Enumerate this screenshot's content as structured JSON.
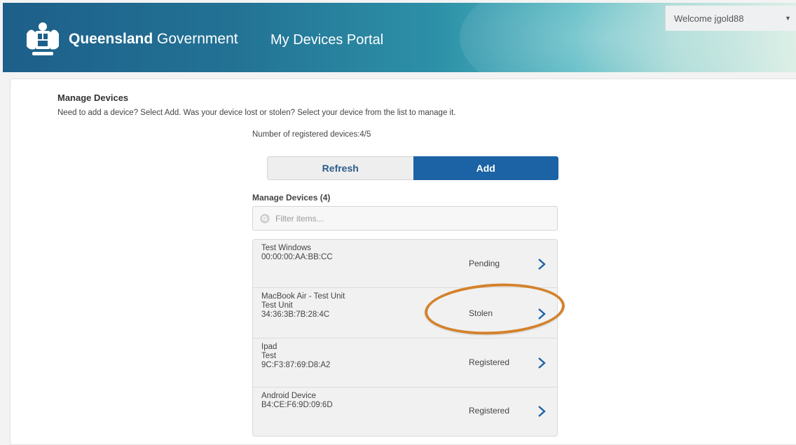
{
  "header": {
    "brand_bold": "Queensland",
    "brand_light": "Government",
    "portal_title": "My Devices Portal",
    "welcome": "Welcome jgold88"
  },
  "main": {
    "title": "Manage Devices",
    "intro": "Need to add a device? Select Add. Was your device lost or stolen? Select your device from the list to manage it.",
    "registered_count": "Number of registered devices:4/5",
    "refresh_label": "Refresh",
    "add_label": "Add",
    "list_title": "Manage Devices (4)",
    "filter_placeholder": "Filter items..."
  },
  "devices": [
    {
      "line1": "Test Windows",
      "line2": "00:00:00:AA:BB:CC",
      "line3": "",
      "status": "Pending"
    },
    {
      "line1": "MacBook Air - Test Unit",
      "line2": "Test Unit",
      "line3": "34:36:3B:7B:28:4C",
      "status": "Stolen"
    },
    {
      "line1": "Ipad",
      "line2": "Test",
      "line3": "9C:F3:87:69:D8:A2",
      "status": "Registered"
    },
    {
      "line1": "Android Device",
      "line2": "B4:CE:F6:9D:09:6D",
      "line3": "",
      "status": "Registered"
    }
  ],
  "colors": {
    "accent": "#1c63a5",
    "highlight": "#d4822c"
  },
  "icons": [
    "crest-logo",
    "search-icon",
    "chevron-right-icon",
    "caret-down-icon"
  ]
}
